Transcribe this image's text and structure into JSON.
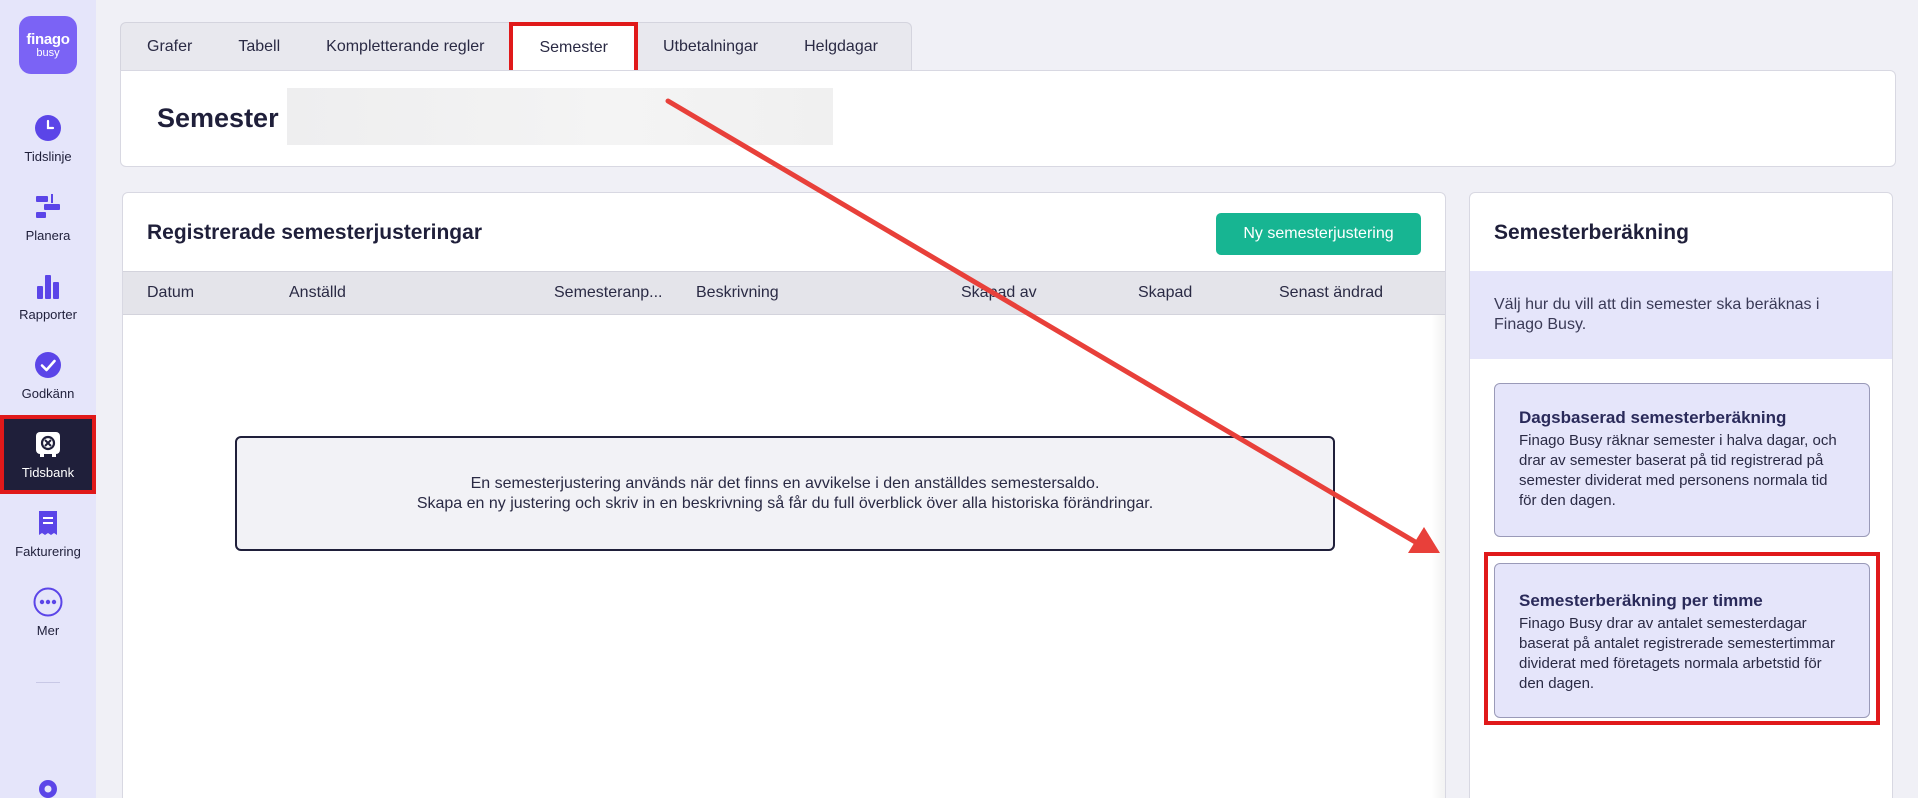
{
  "sidebar": {
    "logo": {
      "line1": "finago",
      "line2": "busy"
    },
    "items": [
      {
        "label": "Tidslinje",
        "icon": "clock-icon"
      },
      {
        "label": "Planera",
        "icon": "plan-icon"
      },
      {
        "label": "Rapporter",
        "icon": "bar-chart-icon"
      },
      {
        "label": "Godkänn",
        "icon": "check-circle-icon"
      },
      {
        "label": "Tidsbank",
        "icon": "safe-icon",
        "active": true
      },
      {
        "label": "Fakturering",
        "icon": "receipt-icon"
      },
      {
        "label": "Mer",
        "icon": "more-icon"
      }
    ],
    "bottom_icon": "settings-icon"
  },
  "tabs": [
    {
      "label": "Grafer"
    },
    {
      "label": "Tabell"
    },
    {
      "label": "Kompletterande regler"
    },
    {
      "label": "Semester",
      "active": true
    },
    {
      "label": "Utbetalningar"
    },
    {
      "label": "Helgdagar"
    }
  ],
  "header": {
    "title": "Semester"
  },
  "adjustments": {
    "title": "Registrerade semesterjusteringar",
    "new_button": "Ny semesterjustering",
    "columns": [
      "Datum",
      "Anställd",
      "Semesteranp...",
      "Beskrivning",
      "Skapad av",
      "Skapad",
      "Senast ändrad"
    ],
    "empty_line1": "En semesterjustering används när det finns en avvikelse i den anställdes semestersaldo.",
    "empty_line2": "Skapa en ny justering och skriv in en beskrivning så får du full överblick över alla historiska förändringar."
  },
  "calculation": {
    "title": "Semesterberäkning",
    "info": "Välj hur du vill att din semester ska beräknas i Finago Busy.",
    "options": [
      {
        "title": "Dagsbaserad semesterberäkning",
        "description": "Finago Busy räknar semester i halva dagar, och drar av semester baserat på tid registrerad på semester dividerat med personens normala tid för den dagen."
      },
      {
        "title": "Semesterberäkning per timme",
        "description": "Finago Busy drar av antalet semesterdagar baserat på antalet registrerade semestertimmar dividerat med företagets normala arbetstid för den dagen.",
        "highlighted": true
      }
    ]
  },
  "colors": {
    "accent": "#7b63f5",
    "primary_button": "#17b592",
    "highlight": "#e0191a",
    "sidebar_bg": "#e5e5fa",
    "dark": "#1f1f3a"
  }
}
